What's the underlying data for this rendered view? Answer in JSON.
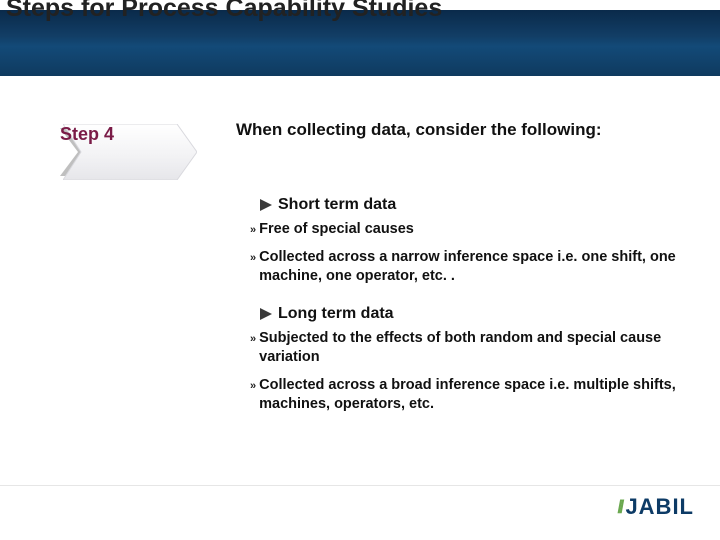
{
  "title": "Steps for Process Capability Studies",
  "step": {
    "label": "Step 4"
  },
  "intro": "When collecting data, consider the following:",
  "sections": [
    {
      "heading": "Short term data",
      "items": [
        "Free of special causes",
        "Collected across a narrow inference space i.e. one shift, one machine, one operator, etc. ."
      ]
    },
    {
      "heading": "Long term data",
      "items": [
        "Subjected to the effects of both random and special cause variation",
        "Collected across a broad inference space i.e. multiple shifts, machines, operators, etc."
      ]
    }
  ],
  "logo": {
    "text": "JABIL"
  },
  "colors": {
    "triangle": "#3a3a3a",
    "stepText": "#7a1b47"
  }
}
